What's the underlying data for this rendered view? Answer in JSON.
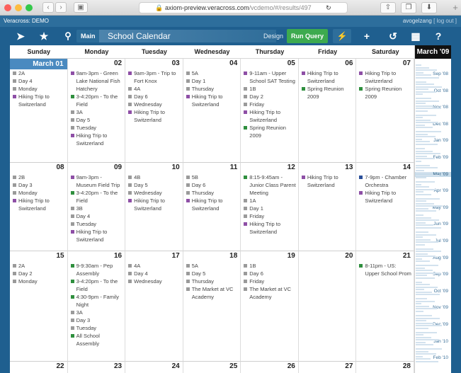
{
  "browser": {
    "url_host": "axiom-preview.veracross.com",
    "url_path": "/vcdemo/#/results/497"
  },
  "app": {
    "brand": "Veracross: DEMO",
    "user": "avogelzang",
    "logout": "[ log out ]"
  },
  "toolbar": {
    "main_label": "Main",
    "page_title": "School Calendar",
    "design_label": "Design",
    "run_query_label": "Run Query"
  },
  "colors": {
    "gray": "#9a9a9a",
    "purple": "#8e4fa6",
    "green": "#2f8f3e",
    "blue": "#2b4f99"
  },
  "calendar": {
    "days": [
      "Sunday",
      "Monday",
      "Tuesday",
      "Wednesday",
      "Thursday",
      "Friday",
      "Saturday"
    ],
    "month_title": "March '09",
    "weeks": [
      [
        {
          "day": "March 01",
          "first": true,
          "events": [
            [
              "gray",
              "2A"
            ],
            [
              "gray",
              "Day 4"
            ],
            [
              "gray",
              "Monday"
            ],
            [
              "purple",
              "Hiking Trip to Switzerland"
            ]
          ]
        },
        {
          "day": "02",
          "events": [
            [
              "purple",
              "9am-3pm - Green Lake National Fish Hatchery"
            ],
            [
              "green",
              "3-4:20pm - To the Field"
            ],
            [
              "gray",
              "3A"
            ],
            [
              "gray",
              "Day 5"
            ],
            [
              "gray",
              "Tuesday"
            ],
            [
              "purple",
              "Hiking Trip to Switzerland"
            ]
          ]
        },
        {
          "day": "03",
          "events": [
            [
              "purple",
              "9am-3pm - Trip to Fort Knox"
            ],
            [
              "gray",
              "4A"
            ],
            [
              "gray",
              "Day 6"
            ],
            [
              "gray",
              "Wednesday"
            ],
            [
              "purple",
              "Hiking Trip to Switzerland"
            ]
          ]
        },
        {
          "day": "04",
          "events": [
            [
              "gray",
              "5A"
            ],
            [
              "gray",
              "Day 1"
            ],
            [
              "gray",
              "Thursday"
            ],
            [
              "purple",
              "Hiking Trip to Switzerland"
            ]
          ]
        },
        {
          "day": "05",
          "events": [
            [
              "purple",
              "9-11am - Upper School SAT Testing"
            ],
            [
              "gray",
              "1B"
            ],
            [
              "gray",
              "Day 2"
            ],
            [
              "gray",
              "Friday"
            ],
            [
              "purple",
              "Hiking Trip to Switzerland"
            ],
            [
              "green",
              "Spring Reunion 2009"
            ]
          ]
        },
        {
          "day": "06",
          "events": [
            [
              "purple",
              "Hiking Trip to Switzerland"
            ],
            [
              "green",
              "Spring Reunion 2009"
            ]
          ]
        },
        {
          "day": "07",
          "events": [
            [
              "purple",
              "Hiking Trip to Switzerland"
            ],
            [
              "green",
              "Spring Reunion 2009"
            ]
          ]
        }
      ],
      [
        {
          "day": "08",
          "events": [
            [
              "gray",
              "2B"
            ],
            [
              "gray",
              "Day 3"
            ],
            [
              "gray",
              "Monday"
            ],
            [
              "purple",
              "Hiking Trip to Switzerland"
            ]
          ]
        },
        {
          "day": "09",
          "events": [
            [
              "purple",
              "9am-3pm - Museum Field Trip"
            ],
            [
              "green",
              "3-4:20pm - To the Field"
            ],
            [
              "gray",
              "3B"
            ],
            [
              "gray",
              "Day 4"
            ],
            [
              "gray",
              "Tuesday"
            ],
            [
              "purple",
              "Hiking Trip to Switzerland"
            ]
          ]
        },
        {
          "day": "10",
          "events": [
            [
              "gray",
              "4B"
            ],
            [
              "gray",
              "Day 5"
            ],
            [
              "gray",
              "Wednesday"
            ],
            [
              "purple",
              "Hiking Trip to Switzerland"
            ]
          ]
        },
        {
          "day": "11",
          "events": [
            [
              "gray",
              "5B"
            ],
            [
              "gray",
              "Day 6"
            ],
            [
              "gray",
              "Thursday"
            ],
            [
              "purple",
              "Hiking Trip to Switzerland"
            ]
          ]
        },
        {
          "day": "12",
          "events": [
            [
              "green",
              "8:15-9:45am - Junior Class Parent Meeting"
            ],
            [
              "gray",
              "1A"
            ],
            [
              "gray",
              "Day 1"
            ],
            [
              "gray",
              "Friday"
            ],
            [
              "purple",
              "Hiking Trip to Switzerland"
            ]
          ]
        },
        {
          "day": "13",
          "events": [
            [
              "purple",
              "Hiking Trip to Switzerland"
            ]
          ]
        },
        {
          "day": "14",
          "events": [
            [
              "blue",
              "7-9pm - Chamber Orchestra"
            ],
            [
              "purple",
              "Hiking Trip to Switzerland"
            ]
          ]
        }
      ],
      [
        {
          "day": "15",
          "events": [
            [
              "gray",
              "2A"
            ],
            [
              "gray",
              "Day 2"
            ],
            [
              "gray",
              "Monday"
            ]
          ]
        },
        {
          "day": "16",
          "events": [
            [
              "green",
              "9-9:30am - Pep Assembly"
            ],
            [
              "green",
              "3-4:20pm - To the Field"
            ],
            [
              "green",
              "4:30-9pm - Family Night"
            ],
            [
              "gray",
              "3A"
            ],
            [
              "gray",
              "Day 3"
            ],
            [
              "gray",
              "Tuesday"
            ],
            [
              "green",
              "All School Assembly"
            ]
          ]
        },
        {
          "day": "17",
          "events": [
            [
              "gray",
              "4A"
            ],
            [
              "gray",
              "Day 4"
            ],
            [
              "gray",
              "Wednesday"
            ]
          ]
        },
        {
          "day": "18",
          "events": [
            [
              "gray",
              "5A"
            ],
            [
              "gray",
              "Day 5"
            ],
            [
              "gray",
              "Thursday"
            ],
            [
              "gray",
              "The Market at VC Academy"
            ]
          ]
        },
        {
          "day": "19",
          "events": [
            [
              "gray",
              "1B"
            ],
            [
              "gray",
              "Day 6"
            ],
            [
              "gray",
              "Friday"
            ],
            [
              "gray",
              "The Market at VC Academy"
            ]
          ]
        },
        {
          "day": "20",
          "events": []
        },
        {
          "day": "21",
          "events": [
            [
              "green",
              "8-11pm - US: Upper School Prom"
            ]
          ]
        }
      ],
      [
        {
          "day": "22",
          "events": []
        },
        {
          "day": "23",
          "events": []
        },
        {
          "day": "24",
          "events": []
        },
        {
          "day": "25",
          "events": []
        },
        {
          "day": "26",
          "events": []
        },
        {
          "day": "27",
          "events": []
        },
        {
          "day": "28",
          "events": []
        }
      ]
    ]
  },
  "months": [
    {
      "label": "Sep '08"
    },
    {
      "label": "Oct '08"
    },
    {
      "label": "Nov '08"
    },
    {
      "label": "Dec '08"
    },
    {
      "label": "Jan '09"
    },
    {
      "label": "Feb '09"
    },
    {
      "label": "Mar '09",
      "current": true
    },
    {
      "label": "Apr '09"
    },
    {
      "label": "May '09"
    },
    {
      "label": "Jun '09"
    },
    {
      "label": "Jul '09"
    },
    {
      "label": "Aug '09"
    },
    {
      "label": "Sep '09"
    },
    {
      "label": "Oct '09"
    },
    {
      "label": "Nov '09"
    },
    {
      "label": "Dec '09"
    },
    {
      "label": "Jan '10"
    },
    {
      "label": "Feb '10"
    }
  ]
}
